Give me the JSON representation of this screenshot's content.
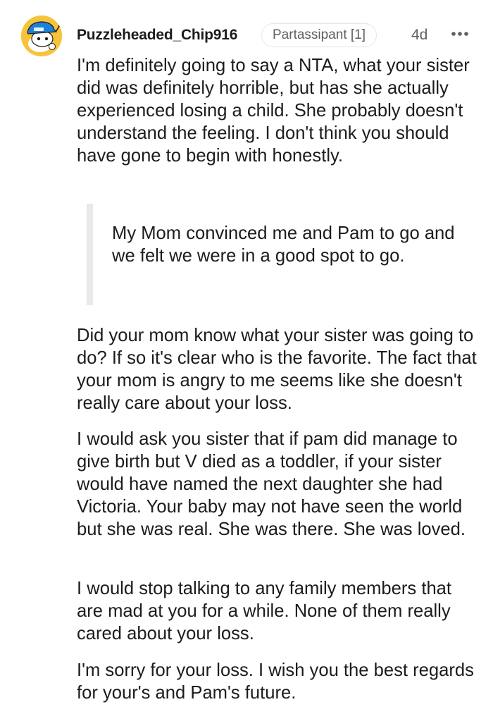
{
  "comment": {
    "author": "Puzzleheaded_Chip916",
    "flair": "Partassipant [1]",
    "age": "4d",
    "more_icon": "ellipsis-horizontal-icon",
    "avatar_icon": "snoo-avatar-icon",
    "paragraphs": [
      "I'm definitely going to say a NTA, what your sister did was definitely horrible, but has she actually experienced losing a child. She probably doesn't understand the feeling. I don't think you should have gone to begin with honestly.",
      "Did your mom know what your sister was going to do? If so it's clear who is the favorite. The fact that your mom is angry to me seems like she doesn't really care about your loss.",
      "I would ask you sister that if pam did manage to give birth but V died as a toddler, if your sister would have named the next daughter she had Victoria. Your baby may not have seen the world but she was real. She was there. She was loved.",
      "I would stop talking to any family members that are mad at you for a while. None of them really cared about your loss.",
      "I'm sorry for your loss. I wish you the best regards for your's and Pam's future."
    ],
    "quote": "My Mom convinced me and Pam to go and we felt we were in a good spot to go."
  },
  "colors": {
    "text": "#1c1c1c",
    "meta": "#5f5f5f",
    "avatar_bg": "#f5c43a",
    "avatar_hat": "#1e7fd8",
    "quote_bar": "#e9e9e9",
    "flair_border": "#e6e6e6"
  }
}
